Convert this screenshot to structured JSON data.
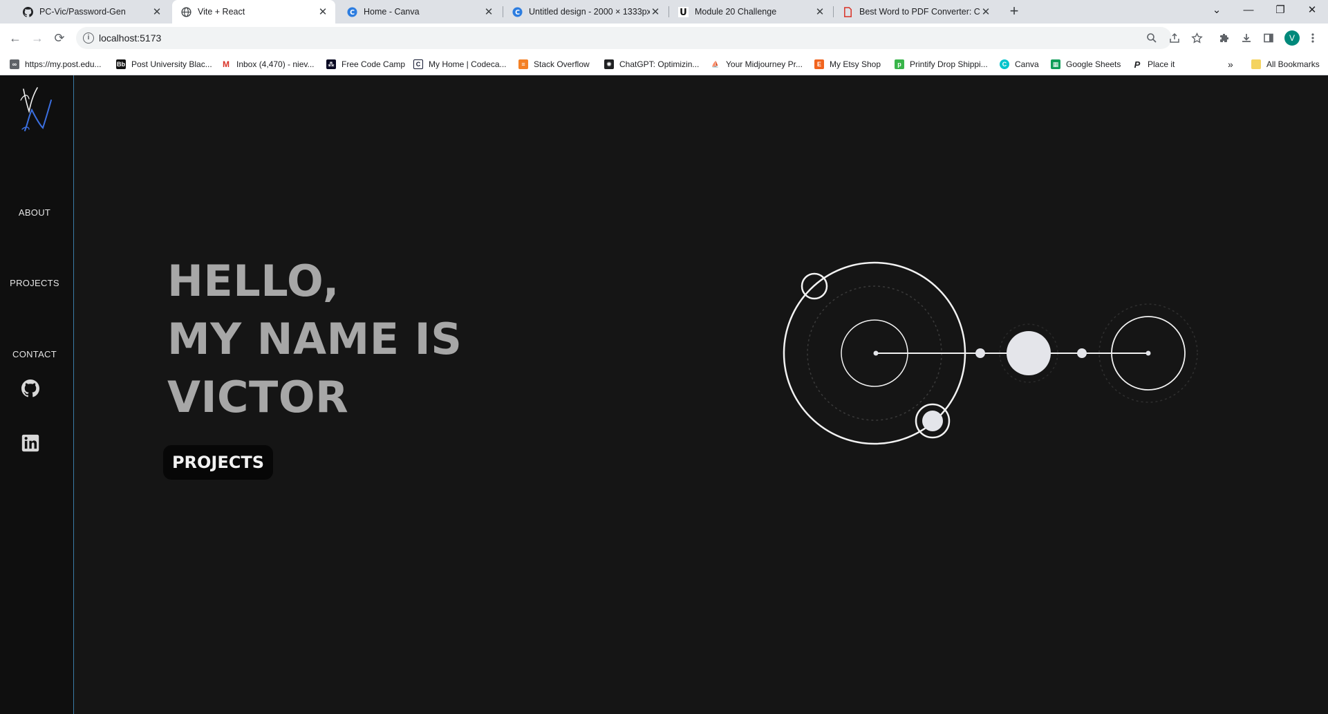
{
  "browser": {
    "tabs": [
      {
        "title": "PC-Vic/Password-Gen",
        "icon": "github-icon",
        "active": false
      },
      {
        "title": "Vite + React",
        "icon": "globe-icon",
        "active": true
      },
      {
        "title": "Home - Canva",
        "icon": "canva-icon",
        "active": false
      },
      {
        "title": "Untitled design - 2000 × 1333px",
        "icon": "canva-icon",
        "active": false
      },
      {
        "title": "Module 20 Challenge",
        "icon": "u-icon",
        "active": false
      },
      {
        "title": "Best Word to PDF Converter: Co",
        "icon": "pdf-icon",
        "active": false
      }
    ],
    "new_tab_label": "+",
    "url": "localhost:5173",
    "profile_initial": "V",
    "bookmarks": [
      {
        "label": "https://my.post.edu...",
        "icon": "link-icon",
        "color": "#5f6368"
      },
      {
        "label": "Post University Blac...",
        "icon": "blackboard-icon",
        "color": "#111111"
      },
      {
        "label": "Inbox (4,470) - niev...",
        "icon": "gmail-icon",
        "color": "#d93025"
      },
      {
        "label": "Free Code Camp",
        "icon": "freecodecamp-icon",
        "color": "#0a0a23"
      },
      {
        "label": "My Home | Codeca...",
        "icon": "codecademy-icon",
        "color": "#10162f"
      },
      {
        "label": "Stack Overflow",
        "icon": "stackoverflow-icon",
        "color": "#f48024"
      },
      {
        "label": "ChatGPT: Optimizin...",
        "icon": "chatgpt-icon",
        "color": "#202123"
      },
      {
        "label": "Your Midjourney Pr...",
        "icon": "midjourney-icon",
        "color": "#4b5563"
      },
      {
        "label": "My Etsy Shop",
        "icon": "etsy-icon",
        "color": "#f1641e"
      },
      {
        "label": "Printify Drop Shippi...",
        "icon": "printify-icon",
        "color": "#39b54a"
      },
      {
        "label": "Canva",
        "icon": "canva-icon",
        "color": "#00c4cc"
      },
      {
        "label": "Google Sheets",
        "icon": "sheets-icon",
        "color": "#0f9d58"
      },
      {
        "label": "Place it",
        "icon": "placeit-icon",
        "color": "#202124"
      }
    ],
    "more_bookmarks": "»",
    "all_bookmarks": "All Bookmarks"
  },
  "sidebar": {
    "logo_text": "VN",
    "nav": [
      {
        "label": "ABOUT"
      },
      {
        "label": "PROJECTS"
      },
      {
        "label": "CONTACT"
      }
    ],
    "social": [
      {
        "icon": "github-icon"
      },
      {
        "icon": "linkedin-icon"
      }
    ]
  },
  "hero": {
    "lines": [
      "HELLO,",
      "MY NAME IS",
      "VICTOR"
    ],
    "cta_label": "PROJECTS"
  },
  "colors": {
    "page_bg": "#151515",
    "sidebar_bg": "#0f0f0f",
    "hero_text": "#a7a7a7",
    "accent_line": "#3a7ca8",
    "logo_blue": "#3b6fe0",
    "orbit_stroke": "#f2f2f2"
  }
}
